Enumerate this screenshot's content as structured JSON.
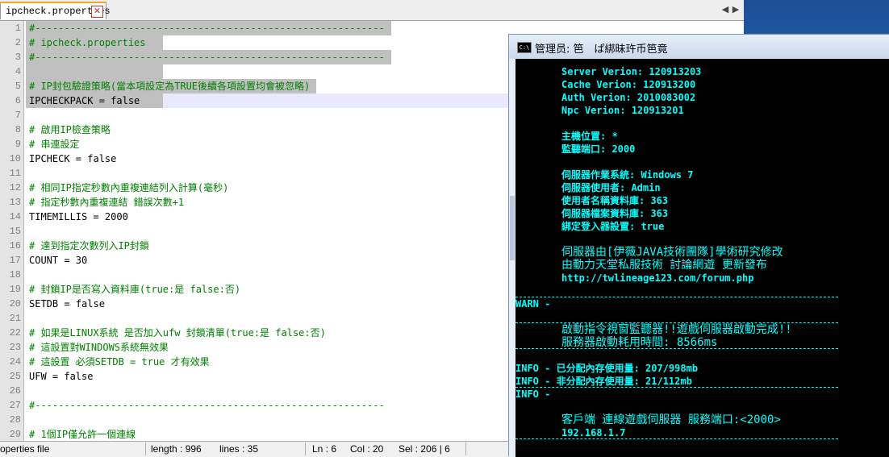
{
  "editor": {
    "tab_label": "ipcheck.properties",
    "tab_close": "✕",
    "lines": [
      {
        "n": "1",
        "t": "#------------------------------------------------------------",
        "k": "comment",
        "hl": true
      },
      {
        "n": "2",
        "t": "# ipcheck.properties",
        "k": "comment",
        "hl": true
      },
      {
        "n": "3",
        "t": "#------------------------------------------------------------",
        "k": "comment",
        "hl": true
      },
      {
        "n": "4",
        "t": "",
        "k": "plain",
        "hl": true
      },
      {
        "n": "5",
        "t": "# IP封包驗證策略(當本項設定為TRUE後續各項設置均會被忽略)",
        "k": "comment",
        "hl": true
      },
      {
        "n": "6",
        "t": "IPCHECKPACK = false",
        "k": "plain",
        "hl": true,
        "sel": true
      },
      {
        "n": "7",
        "t": "",
        "k": "plain"
      },
      {
        "n": "8",
        "t": "# 啟用IP檢查策略",
        "k": "comment"
      },
      {
        "n": "9",
        "t": "# 串連設定",
        "k": "comment"
      },
      {
        "n": "10",
        "t": "IPCHECK = false",
        "k": "plain"
      },
      {
        "n": "11",
        "t": "",
        "k": "plain"
      },
      {
        "n": "12",
        "t": "# 相同IP指定秒數內重複連結列入計算(毫秒)",
        "k": "comment"
      },
      {
        "n": "13",
        "t": "# 指定秒數內重複連結 錯誤次數+1",
        "k": "comment"
      },
      {
        "n": "14",
        "t": "TIMEMILLIS = 2000",
        "k": "plain"
      },
      {
        "n": "15",
        "t": "",
        "k": "plain"
      },
      {
        "n": "16",
        "t": "# 達到指定次數列入IP封鎖",
        "k": "comment"
      },
      {
        "n": "17",
        "t": "COUNT = 30",
        "k": "plain"
      },
      {
        "n": "18",
        "t": "",
        "k": "plain"
      },
      {
        "n": "19",
        "t": "# 封鎖IP是否寫入資料庫(true:是 false:否)",
        "k": "comment"
      },
      {
        "n": "20",
        "t": "SETDB = false",
        "k": "plain"
      },
      {
        "n": "21",
        "t": "",
        "k": "plain"
      },
      {
        "n": "22",
        "t": "# 如果是LINUX系統 是否加入ufw 封鎖清單(true:是 false:否)",
        "k": "comment"
      },
      {
        "n": "23",
        "t": "# 這設置對WINDOWS系統無效果",
        "k": "comment"
      },
      {
        "n": "24",
        "t": "# 這設置 必須SETDB = true 才有效果",
        "k": "comment"
      },
      {
        "n": "25",
        "t": "UFW = false",
        "k": "plain"
      },
      {
        "n": "26",
        "t": "",
        "k": "plain"
      },
      {
        "n": "27",
        "t": "#------------------------------------------------------------",
        "k": "comment"
      },
      {
        "n": "28",
        "t": "",
        "k": "plain"
      },
      {
        "n": "29",
        "t": "# 1個IP僅允許一個連線",
        "k": "comment"
      }
    ]
  },
  "status": {
    "file_type": "operties file",
    "length": "length : 996",
    "lines": "lines : 35",
    "ln": "Ln : 6",
    "col": "Col : 20",
    "sel": "Sel : 206 | 6"
  },
  "console": {
    "title": "管理员: 笆　ぱ綁昧玝币笆竟",
    "icon_text": "C:\\",
    "lines": [
      {
        "t": "Server Verion: 120913203",
        "ind": true,
        "y": 0
      },
      {
        "t": "Cache Verion: 120913200",
        "ind": true,
        "y": 1
      },
      {
        "t": "Auth Verion: 2010083002",
        "ind": true,
        "y": 2
      },
      {
        "t": "Npc Verion: 120913201",
        "ind": true,
        "y": 3
      },
      {
        "t": "主機位置: *",
        "ind": true,
        "y": 5
      },
      {
        "t": "監聽端口: 2000",
        "ind": true,
        "y": 6
      },
      {
        "t": "伺服器作業系統: Windows 7",
        "ind": true,
        "y": 8
      },
      {
        "t": "伺服器使用者: Admin",
        "ind": true,
        "y": 9
      },
      {
        "t": "使用者名稱資料庫: 363",
        "ind": true,
        "y": 10
      },
      {
        "t": "伺服器檔案資料庫: 363",
        "ind": true,
        "y": 11
      },
      {
        "t": "綁定登入器設置: true",
        "ind": true,
        "y": 12
      },
      {
        "t": "伺服器由[伊薇JAVA技術團隊]學術研究修改",
        "ind": true,
        "y": 14,
        "cjk": true
      },
      {
        "t": "由動力天堂私服技術 討論網遊 更新發布",
        "ind": true,
        "y": 15,
        "cjk": true
      },
      {
        "t": "http://twlineage123.com/forum.php",
        "ind": true,
        "y": 16
      },
      {
        "t": "WARN -",
        "ind": false,
        "y": 18
      },
      {
        "t": "啟動指令視窗監聽器!!遊戲伺服器啟動完成!!",
        "ind": true,
        "y": 20,
        "cjk": true
      },
      {
        "t": "服務器啟動耗用時間: 8566ms",
        "ind": true,
        "y": 21,
        "cjk": true
      },
      {
        "t": "INFO - 已分配內存使用量: 207/998mb",
        "ind": false,
        "y": 23
      },
      {
        "t": "INFO - 非分配內存使用量: 21/112mb",
        "ind": false,
        "y": 24
      },
      {
        "t": "INFO -",
        "ind": false,
        "y": 25
      },
      {
        "t": "客戶端 連線遊戲伺服器 服務端口:<2000>",
        "ind": true,
        "y": 27,
        "cjk": true
      },
      {
        "t": "192.168.1.7",
        "ind": true,
        "y": 28
      }
    ]
  }
}
